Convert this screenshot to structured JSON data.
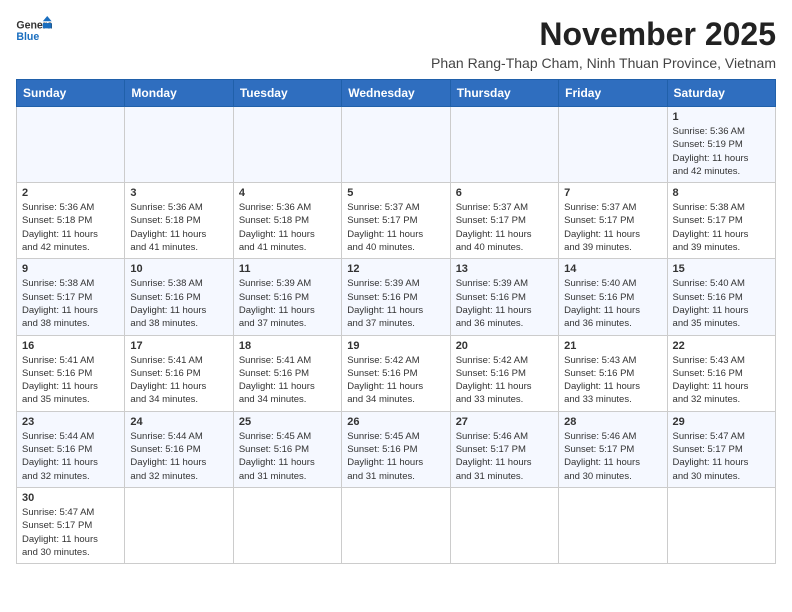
{
  "header": {
    "logo_line1": "General",
    "logo_line2": "Blue",
    "month_title": "November 2025",
    "location": "Phan Rang-Thap Cham, Ninh Thuan Province, Vietnam"
  },
  "weekdays": [
    "Sunday",
    "Monday",
    "Tuesday",
    "Wednesday",
    "Thursday",
    "Friday",
    "Saturday"
  ],
  "weeks": [
    [
      {
        "day": "",
        "info": ""
      },
      {
        "day": "",
        "info": ""
      },
      {
        "day": "",
        "info": ""
      },
      {
        "day": "",
        "info": ""
      },
      {
        "day": "",
        "info": ""
      },
      {
        "day": "",
        "info": ""
      },
      {
        "day": "1",
        "info": "Sunrise: 5:36 AM\nSunset: 5:19 PM\nDaylight: 11 hours\nand 42 minutes."
      }
    ],
    [
      {
        "day": "2",
        "info": "Sunrise: 5:36 AM\nSunset: 5:18 PM\nDaylight: 11 hours\nand 42 minutes."
      },
      {
        "day": "3",
        "info": "Sunrise: 5:36 AM\nSunset: 5:18 PM\nDaylight: 11 hours\nand 41 minutes."
      },
      {
        "day": "4",
        "info": "Sunrise: 5:36 AM\nSunset: 5:18 PM\nDaylight: 11 hours\nand 41 minutes."
      },
      {
        "day": "5",
        "info": "Sunrise: 5:37 AM\nSunset: 5:17 PM\nDaylight: 11 hours\nand 40 minutes."
      },
      {
        "day": "6",
        "info": "Sunrise: 5:37 AM\nSunset: 5:17 PM\nDaylight: 11 hours\nand 40 minutes."
      },
      {
        "day": "7",
        "info": "Sunrise: 5:37 AM\nSunset: 5:17 PM\nDaylight: 11 hours\nand 39 minutes."
      },
      {
        "day": "8",
        "info": "Sunrise: 5:38 AM\nSunset: 5:17 PM\nDaylight: 11 hours\nand 39 minutes."
      }
    ],
    [
      {
        "day": "9",
        "info": "Sunrise: 5:38 AM\nSunset: 5:17 PM\nDaylight: 11 hours\nand 38 minutes."
      },
      {
        "day": "10",
        "info": "Sunrise: 5:38 AM\nSunset: 5:16 PM\nDaylight: 11 hours\nand 38 minutes."
      },
      {
        "day": "11",
        "info": "Sunrise: 5:39 AM\nSunset: 5:16 PM\nDaylight: 11 hours\nand 37 minutes."
      },
      {
        "day": "12",
        "info": "Sunrise: 5:39 AM\nSunset: 5:16 PM\nDaylight: 11 hours\nand 37 minutes."
      },
      {
        "day": "13",
        "info": "Sunrise: 5:39 AM\nSunset: 5:16 PM\nDaylight: 11 hours\nand 36 minutes."
      },
      {
        "day": "14",
        "info": "Sunrise: 5:40 AM\nSunset: 5:16 PM\nDaylight: 11 hours\nand 36 minutes."
      },
      {
        "day": "15",
        "info": "Sunrise: 5:40 AM\nSunset: 5:16 PM\nDaylight: 11 hours\nand 35 minutes."
      }
    ],
    [
      {
        "day": "16",
        "info": "Sunrise: 5:41 AM\nSunset: 5:16 PM\nDaylight: 11 hours\nand 35 minutes."
      },
      {
        "day": "17",
        "info": "Sunrise: 5:41 AM\nSunset: 5:16 PM\nDaylight: 11 hours\nand 34 minutes."
      },
      {
        "day": "18",
        "info": "Sunrise: 5:41 AM\nSunset: 5:16 PM\nDaylight: 11 hours\nand 34 minutes."
      },
      {
        "day": "19",
        "info": "Sunrise: 5:42 AM\nSunset: 5:16 PM\nDaylight: 11 hours\nand 34 minutes."
      },
      {
        "day": "20",
        "info": "Sunrise: 5:42 AM\nSunset: 5:16 PM\nDaylight: 11 hours\nand 33 minutes."
      },
      {
        "day": "21",
        "info": "Sunrise: 5:43 AM\nSunset: 5:16 PM\nDaylight: 11 hours\nand 33 minutes."
      },
      {
        "day": "22",
        "info": "Sunrise: 5:43 AM\nSunset: 5:16 PM\nDaylight: 11 hours\nand 32 minutes."
      }
    ],
    [
      {
        "day": "23",
        "info": "Sunrise: 5:44 AM\nSunset: 5:16 PM\nDaylight: 11 hours\nand 32 minutes."
      },
      {
        "day": "24",
        "info": "Sunrise: 5:44 AM\nSunset: 5:16 PM\nDaylight: 11 hours\nand 32 minutes."
      },
      {
        "day": "25",
        "info": "Sunrise: 5:45 AM\nSunset: 5:16 PM\nDaylight: 11 hours\nand 31 minutes."
      },
      {
        "day": "26",
        "info": "Sunrise: 5:45 AM\nSunset: 5:16 PM\nDaylight: 11 hours\nand 31 minutes."
      },
      {
        "day": "27",
        "info": "Sunrise: 5:46 AM\nSunset: 5:17 PM\nDaylight: 11 hours\nand 31 minutes."
      },
      {
        "day": "28",
        "info": "Sunrise: 5:46 AM\nSunset: 5:17 PM\nDaylight: 11 hours\nand 30 minutes."
      },
      {
        "day": "29",
        "info": "Sunrise: 5:47 AM\nSunset: 5:17 PM\nDaylight: 11 hours\nand 30 minutes."
      }
    ],
    [
      {
        "day": "30",
        "info": "Sunrise: 5:47 AM\nSunset: 5:17 PM\nDaylight: 11 hours\nand 30 minutes."
      },
      {
        "day": "",
        "info": ""
      },
      {
        "day": "",
        "info": ""
      },
      {
        "day": "",
        "info": ""
      },
      {
        "day": "",
        "info": ""
      },
      {
        "day": "",
        "info": ""
      },
      {
        "day": "",
        "info": ""
      }
    ]
  ]
}
